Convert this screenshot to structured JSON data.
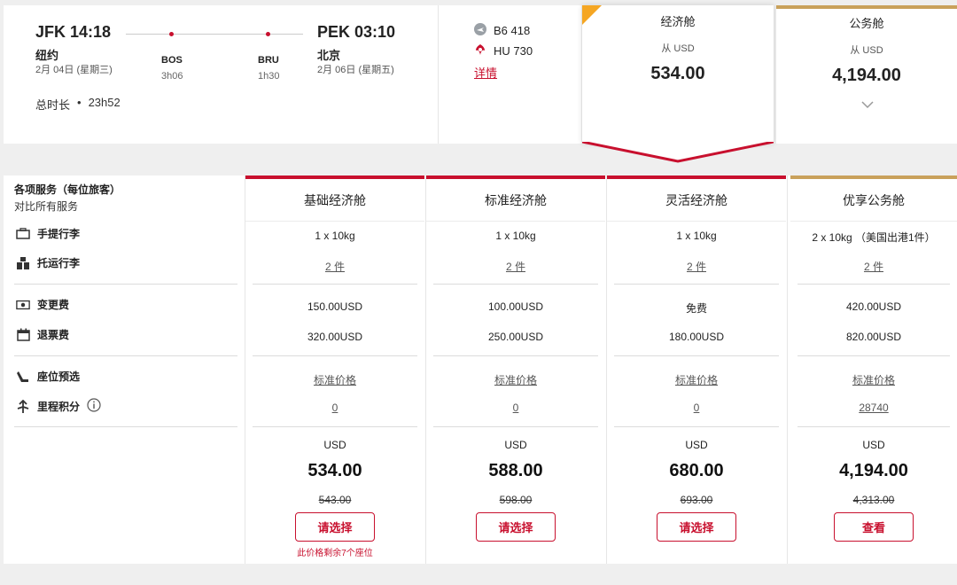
{
  "itinerary": {
    "origin": {
      "code_time": "JFK 14:18",
      "city": "纽约",
      "date": "2月 04日 (星期三)"
    },
    "destination": {
      "code_time": "PEK 03:10",
      "city": "北京",
      "date": "2月 06日 (星期五)"
    },
    "stops": [
      {
        "code": "BOS",
        "duration": "3h06"
      },
      {
        "code": "BRU",
        "duration": "1h30"
      }
    ],
    "total_label": "总时长",
    "total_bullet": "•",
    "total_value": "23h52"
  },
  "carriers": [
    {
      "icon": "jetblue-logo-icon",
      "flight": "B6 418"
    },
    {
      "icon": "hainan-airlines-logo-icon",
      "flight": "HU 730"
    }
  ],
  "details_label": "详情",
  "cabin_headers": [
    {
      "title": "经济舱",
      "from": "从 USD",
      "price": "534.00",
      "selected": true
    },
    {
      "title": "公务舱",
      "from": "从 USD",
      "price": "4,194.00",
      "selected": false
    }
  ],
  "services": {
    "title": "各项服务（每位旅客）",
    "subtitle": "对比所有服务",
    "rows": [
      {
        "label": "手提行李",
        "icon": "carry-on-bag-icon"
      },
      {
        "label": "托运行李",
        "icon": "checked-bag-icon"
      },
      {
        "label": "变更费",
        "icon": "change-fee-icon"
      },
      {
        "label": "退票费",
        "icon": "refund-fee-icon"
      },
      {
        "label": "座位预选",
        "icon": "seat-icon"
      },
      {
        "label": "里程积分",
        "icon": "miles-icon"
      }
    ],
    "info_icon": "info-icon"
  },
  "fares": [
    {
      "name": "基础经济舱",
      "carry_on": "1 x 10kg",
      "checked": "2 件",
      "change_fee": "150.00USD",
      "refund_fee": "320.00USD",
      "seat": "标准价格",
      "miles": "0",
      "currency": "USD",
      "price": "534.00",
      "old_price": "543.00",
      "button": "请选择",
      "note": "此价格剩余7个座位"
    },
    {
      "name": "标准经济舱",
      "carry_on": "1 x 10kg",
      "checked": "2 件",
      "change_fee": "100.00USD",
      "refund_fee": "250.00USD",
      "seat": "标准价格",
      "miles": "0",
      "currency": "USD",
      "price": "588.00",
      "old_price": "598.00",
      "button": "请选择",
      "note": ""
    },
    {
      "name": "灵活经济舱",
      "carry_on": "1 x 10kg",
      "checked": "2 件",
      "change_fee": "免费",
      "refund_fee": "180.00USD",
      "seat": "标准价格",
      "miles": "0",
      "currency": "USD",
      "price": "680.00",
      "old_price": "693.00",
      "button": "请选择",
      "note": ""
    },
    {
      "name": "优享公务舱",
      "carry_on": "2 x 10kg （美国出港1件）",
      "checked": "2 件",
      "change_fee": "420.00USD",
      "refund_fee": "820.00USD",
      "seat": "标准价格",
      "miles": "28740",
      "currency": "USD",
      "price": "4,194.00",
      "old_price": "4,313.00",
      "button": "查看",
      "note": ""
    }
  ],
  "colors": {
    "accent_red": "#c8102e",
    "business_gold": "#c9a15b",
    "economy_corner": "#f5a623"
  }
}
